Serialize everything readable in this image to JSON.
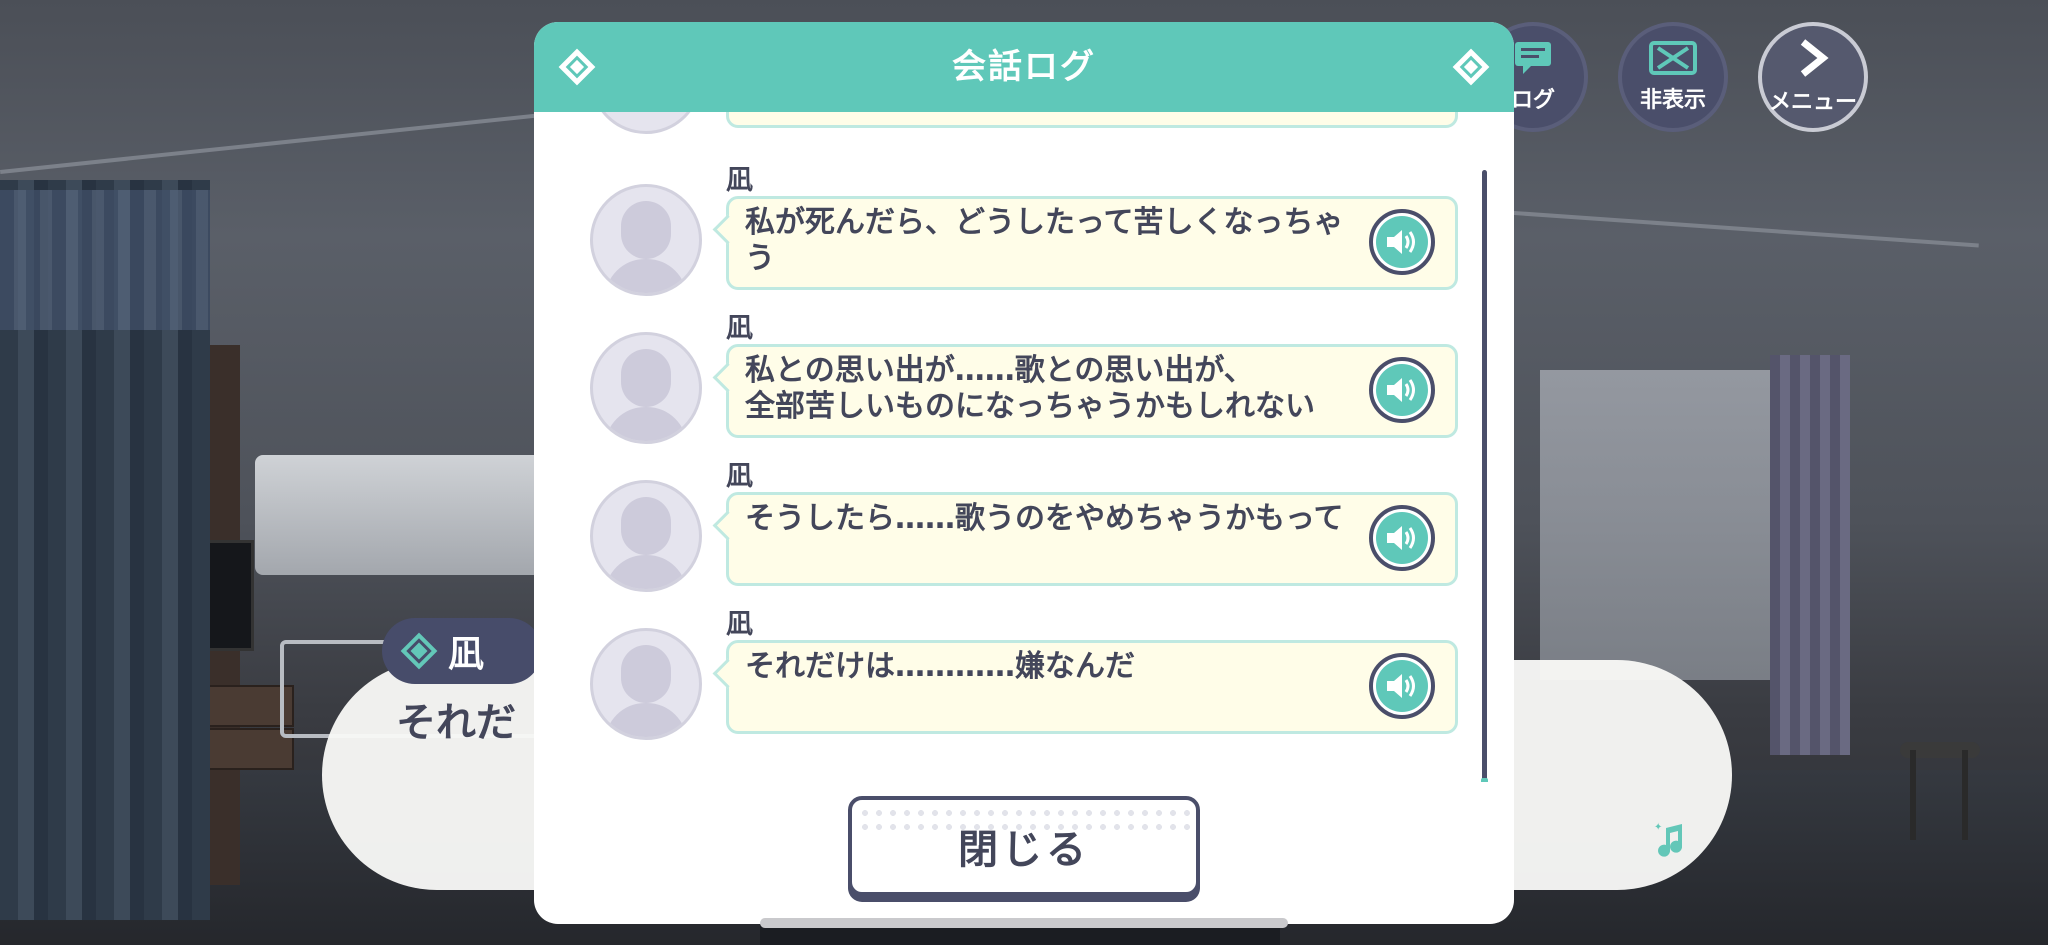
{
  "modal": {
    "title": "会話ログ",
    "close_label": "閉じる"
  },
  "log_entries": [
    {
      "speaker": "凪",
      "text": "私が死んだら、どうしたって苦しくなっちゃ\nう"
    },
    {
      "speaker": "凪",
      "text": "私との思い出が……歌との思い出が、\n全部苦しいものになっちゃうかもしれない"
    },
    {
      "speaker": "凪",
      "text": "そうしたら……歌うのをやめちゃうかもって"
    },
    {
      "speaker": "凪",
      "text": "それだけは…………嫌なんだ"
    }
  ],
  "controls": {
    "log_label": "ログ",
    "hide_label": "非表示",
    "menu_label": "メニュー"
  },
  "background_dialogue": {
    "speaker": "凪",
    "text": "それだ"
  },
  "colors": {
    "accent_teal": "#5fc8b9",
    "navy": "#4a4e6a",
    "bubble_bg": "#fffde8",
    "text": "#43465a"
  },
  "icons": {
    "voice": "speaker-volume-icon",
    "log": "chat-bubble-icon",
    "hide": "x-box-icon",
    "menu": "chevron-right-icon"
  }
}
